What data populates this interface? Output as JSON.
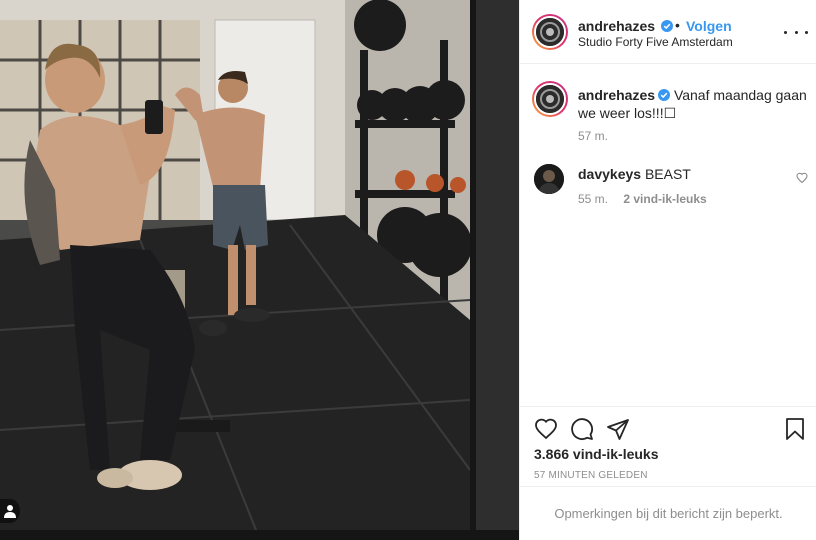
{
  "post": {
    "author": "andrehazes",
    "follow_label": "Volgen",
    "separator": "•",
    "location": "Studio Forty Five Amsterdam"
  },
  "caption": {
    "author": "andrehazes",
    "text": "Vanaf maandag gaan we weer los!!!☐",
    "time": "57 m."
  },
  "comments": [
    {
      "author": "davykeys",
      "text": "BEAST",
      "time": "55 m.",
      "likes": "2 vind-ik-leuks"
    }
  ],
  "actions": {
    "like_icon": "heart-icon",
    "comment_icon": "comment-bubble-icon",
    "share_icon": "paper-plane-icon",
    "save_icon": "bookmark-icon"
  },
  "stats": {
    "likes": "3.866 vind-ik-leuks",
    "date": "57 MINUTEN GELEDEN"
  },
  "footer": {
    "comments_restricted": "Opmerkingen bij dit bericht zijn beperkt."
  },
  "colors": {
    "link_blue": "#3897f0",
    "verified_blue": "#3897f0",
    "muted": "#8e8e8e",
    "text": "#262626"
  }
}
